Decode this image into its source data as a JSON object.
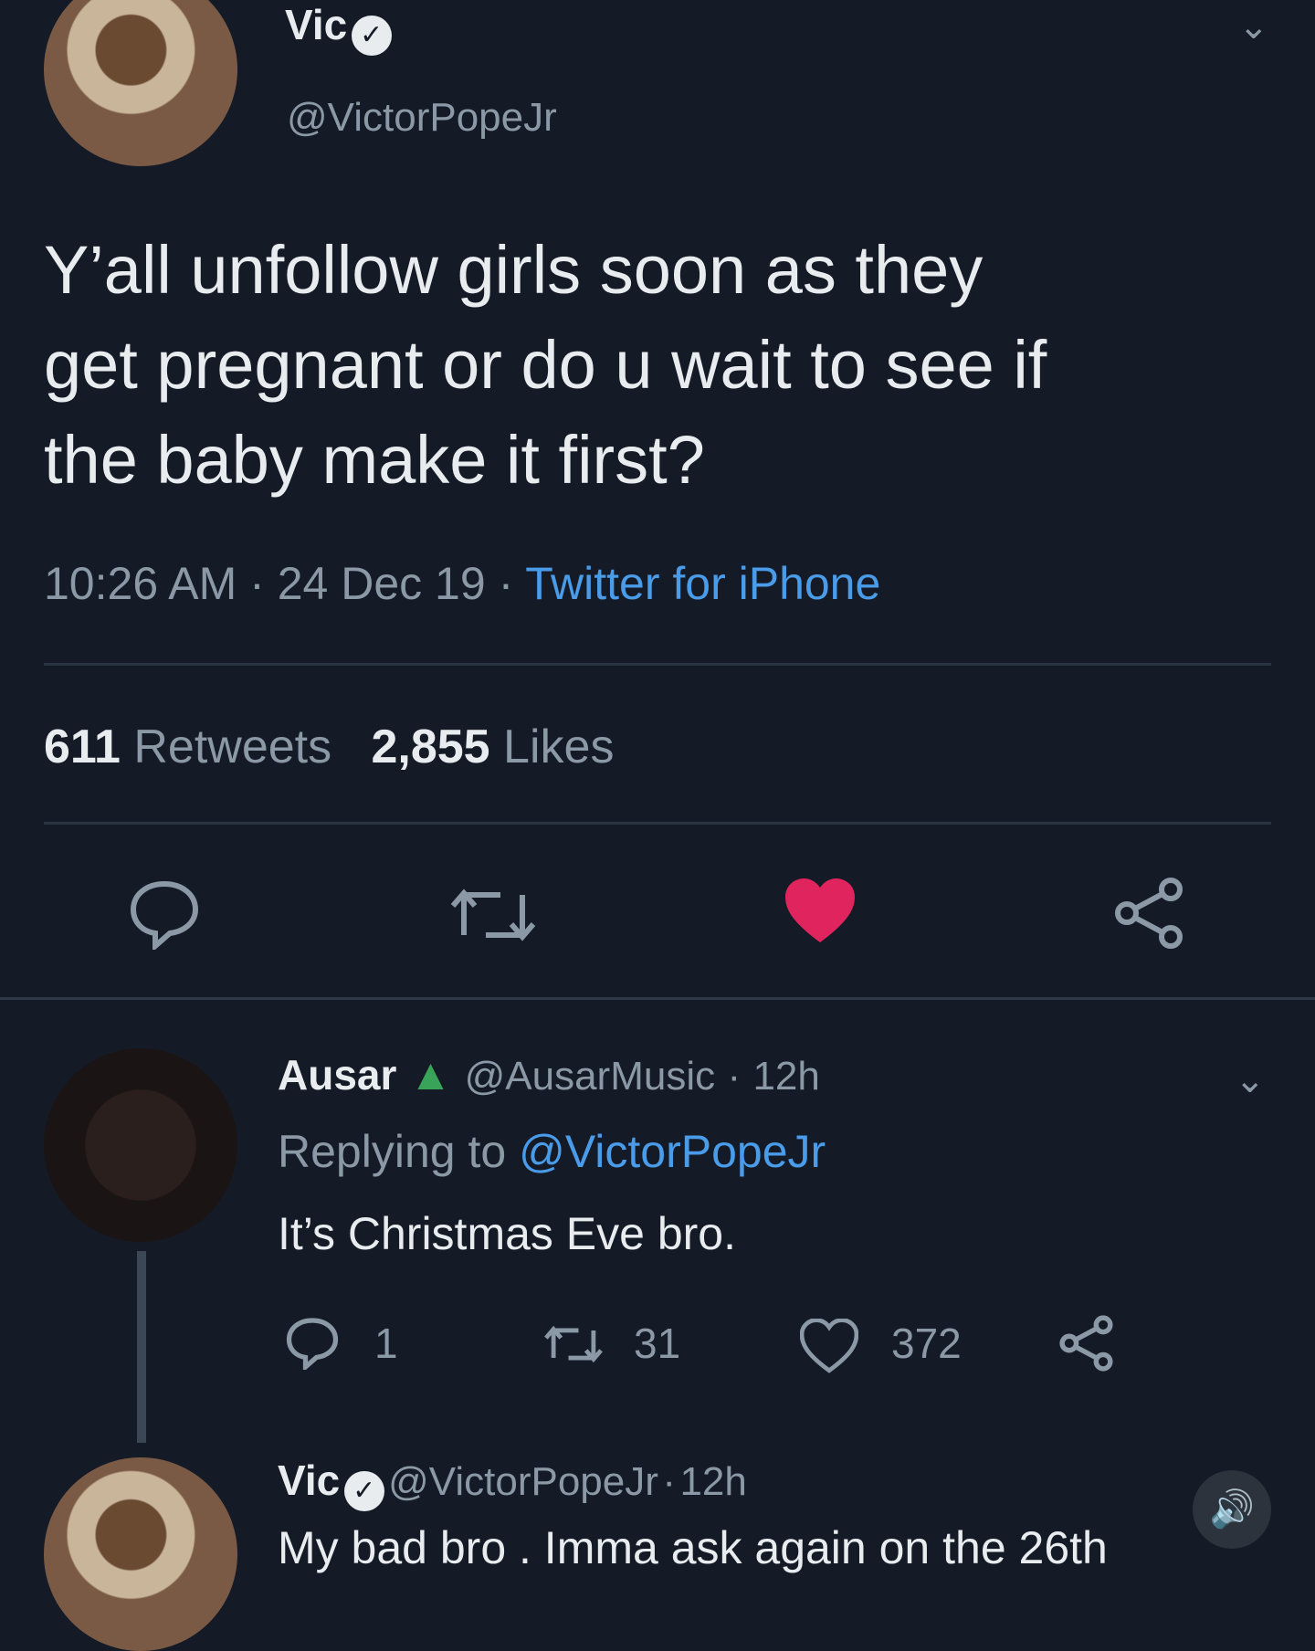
{
  "tweet": {
    "author_name": "Vic",
    "author_handle": "@VictorPopeJr",
    "text_line1": "Y’all unfollow girls soon as they",
    "text_line2": "get pregnant or do u wait to see if",
    "text_line3": "the baby make it first?",
    "time": "10:26 AM",
    "date": "24 Dec 19",
    "source": "Twitter for iPhone",
    "retweets_count": "611",
    "retweets_label": "Retweets",
    "likes_count": "2,855",
    "likes_label": "Likes",
    "liked": true
  },
  "reply": {
    "author_name": "Ausar",
    "author_handle": "@AusarMusic",
    "age": "12h",
    "replying_to_prefix": "Replying to",
    "replying_to_handle": "@VictorPopeJr",
    "text": "It’s Christmas Eve bro.",
    "reply_count": "1",
    "retweet_count": "31",
    "like_count": "372"
  },
  "reply2": {
    "author_name": "Vic",
    "author_handle": "@VictorPopeJr",
    "age": "12h",
    "text": "My bad bro . Imma ask again on the 26th"
  },
  "colors": {
    "background": "#141a26",
    "accent_blue": "#4a9be8",
    "like_red": "#e0245e",
    "muted": "#8b98a5"
  },
  "icons": [
    "reply-icon",
    "retweet-icon",
    "heart-icon",
    "share-icon",
    "chevron-down-icon",
    "verified-icon",
    "tree-icon",
    "volume-icon"
  ]
}
